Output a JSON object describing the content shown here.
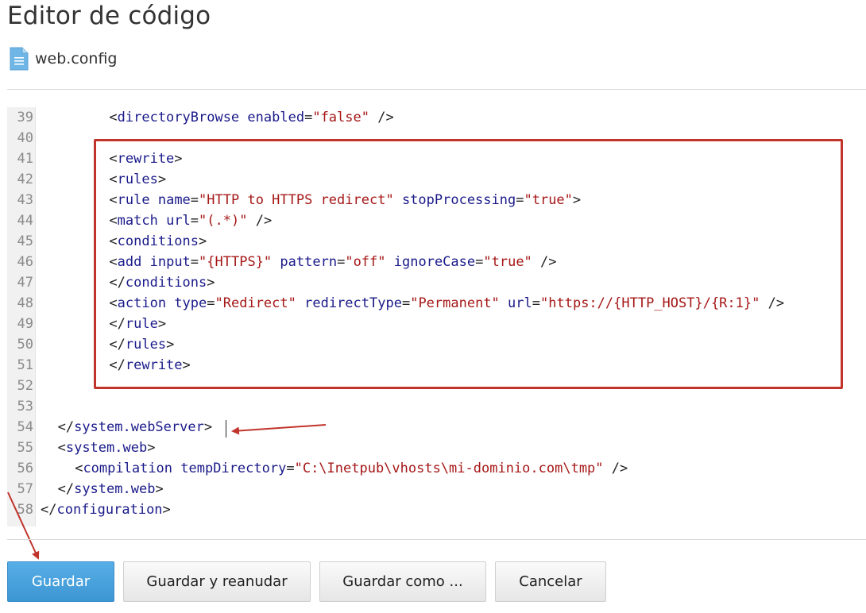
{
  "header": {
    "title": "Editor de código",
    "file_icon": "file-icon",
    "file_name": "web.config"
  },
  "colors": {
    "primary_button": "#4aa3dd",
    "annotation_red": "#c0342b",
    "tag_color": "#1a1a8a",
    "string_color": "#a61717"
  },
  "editor": {
    "lines": [
      {
        "n": "39",
        "indent": 8,
        "tokens": [
          [
            "p",
            "<"
          ],
          [
            "t",
            "directoryBrowse"
          ],
          [
            "p",
            " "
          ],
          [
            "a",
            "enabled"
          ],
          [
            "p",
            "="
          ],
          [
            "s",
            "\"false\""
          ],
          [
            "p",
            " />"
          ]
        ]
      },
      {
        "n": "40",
        "indent": 0,
        "tokens": []
      },
      {
        "n": "41",
        "indent": 8,
        "tokens": [
          [
            "p",
            "<"
          ],
          [
            "t",
            "rewrite"
          ],
          [
            "p",
            ">"
          ]
        ]
      },
      {
        "n": "42",
        "indent": 8,
        "tokens": [
          [
            "p",
            "<"
          ],
          [
            "t",
            "rules"
          ],
          [
            "p",
            ">"
          ]
        ]
      },
      {
        "n": "43",
        "indent": 8,
        "tokens": [
          [
            "p",
            "<"
          ],
          [
            "t",
            "rule"
          ],
          [
            "p",
            " "
          ],
          [
            "a",
            "name"
          ],
          [
            "p",
            "="
          ],
          [
            "s",
            "\"HTTP to HTTPS redirect\""
          ],
          [
            "p",
            " "
          ],
          [
            "a",
            "stopProcessing"
          ],
          [
            "p",
            "="
          ],
          [
            "s",
            "\"true\""
          ],
          [
            "p",
            ">"
          ]
        ]
      },
      {
        "n": "44",
        "indent": 8,
        "tokens": [
          [
            "p",
            "<"
          ],
          [
            "t",
            "match"
          ],
          [
            "p",
            " "
          ],
          [
            "a",
            "url"
          ],
          [
            "p",
            "="
          ],
          [
            "s",
            "\"(.*)\""
          ],
          [
            "p",
            " />"
          ]
        ]
      },
      {
        "n": "45",
        "indent": 8,
        "tokens": [
          [
            "p",
            "<"
          ],
          [
            "t",
            "conditions"
          ],
          [
            "p",
            ">"
          ]
        ]
      },
      {
        "n": "46",
        "indent": 8,
        "tokens": [
          [
            "p",
            "<"
          ],
          [
            "t",
            "add"
          ],
          [
            "p",
            " "
          ],
          [
            "a",
            "input"
          ],
          [
            "p",
            "="
          ],
          [
            "s",
            "\"{HTTPS}\""
          ],
          [
            "p",
            " "
          ],
          [
            "a",
            "pattern"
          ],
          [
            "p",
            "="
          ],
          [
            "s",
            "\"off\""
          ],
          [
            "p",
            " "
          ],
          [
            "a",
            "ignoreCase"
          ],
          [
            "p",
            "="
          ],
          [
            "s",
            "\"true\""
          ],
          [
            "p",
            " />"
          ]
        ]
      },
      {
        "n": "47",
        "indent": 8,
        "tokens": [
          [
            "p",
            "</"
          ],
          [
            "t",
            "conditions"
          ],
          [
            "p",
            ">"
          ]
        ]
      },
      {
        "n": "48",
        "indent": 8,
        "tokens": [
          [
            "p",
            "<"
          ],
          [
            "t",
            "action"
          ],
          [
            "p",
            " "
          ],
          [
            "a",
            "type"
          ],
          [
            "p",
            "="
          ],
          [
            "s",
            "\"Redirect\""
          ],
          [
            "p",
            " "
          ],
          [
            "a",
            "redirectType"
          ],
          [
            "p",
            "="
          ],
          [
            "s",
            "\"Permanent\""
          ],
          [
            "p",
            " "
          ],
          [
            "a",
            "url"
          ],
          [
            "p",
            "="
          ],
          [
            "s",
            "\"https://{HTTP_HOST}/{R:1}\""
          ],
          [
            "p",
            " />"
          ]
        ]
      },
      {
        "n": "49",
        "indent": 8,
        "tokens": [
          [
            "p",
            "</"
          ],
          [
            "t",
            "rule"
          ],
          [
            "p",
            ">"
          ]
        ]
      },
      {
        "n": "50",
        "indent": 8,
        "tokens": [
          [
            "p",
            "</"
          ],
          [
            "t",
            "rules"
          ],
          [
            "p",
            ">"
          ]
        ]
      },
      {
        "n": "51",
        "indent": 8,
        "tokens": [
          [
            "p",
            "</"
          ],
          [
            "t",
            "rewrite"
          ],
          [
            "p",
            ">"
          ]
        ]
      },
      {
        "n": "52",
        "indent": 0,
        "tokens": []
      },
      {
        "n": "53",
        "indent": 0,
        "tokens": []
      },
      {
        "n": "54",
        "indent": 2,
        "tokens": [
          [
            "p",
            "</"
          ],
          [
            "t",
            "system.webServer"
          ],
          [
            "p",
            ">"
          ]
        ]
      },
      {
        "n": "55",
        "indent": 2,
        "tokens": [
          [
            "p",
            "<"
          ],
          [
            "t",
            "system.web"
          ],
          [
            "p",
            ">"
          ]
        ]
      },
      {
        "n": "56",
        "indent": 4,
        "tokens": [
          [
            "p",
            "<"
          ],
          [
            "t",
            "compilation"
          ],
          [
            "p",
            " "
          ],
          [
            "a",
            "tempDirectory"
          ],
          [
            "p",
            "="
          ],
          [
            "s",
            "\"C:\\Inetpub\\vhosts\\mi-dominio.com\\tmp\""
          ],
          [
            "p",
            " />"
          ]
        ]
      },
      {
        "n": "57",
        "indent": 2,
        "tokens": [
          [
            "p",
            "</"
          ],
          [
            "t",
            "system.web"
          ],
          [
            "p",
            ">"
          ]
        ]
      },
      {
        "n": "58",
        "indent": 0,
        "tokens": [
          [
            "p",
            "</"
          ],
          [
            "t",
            "configuration"
          ],
          [
            "p",
            ">"
          ]
        ]
      }
    ]
  },
  "buttons": {
    "save": "Guardar",
    "save_restart": "Guardar y reanudar",
    "save_as": "Guardar como ...",
    "cancel": "Cancelar"
  }
}
